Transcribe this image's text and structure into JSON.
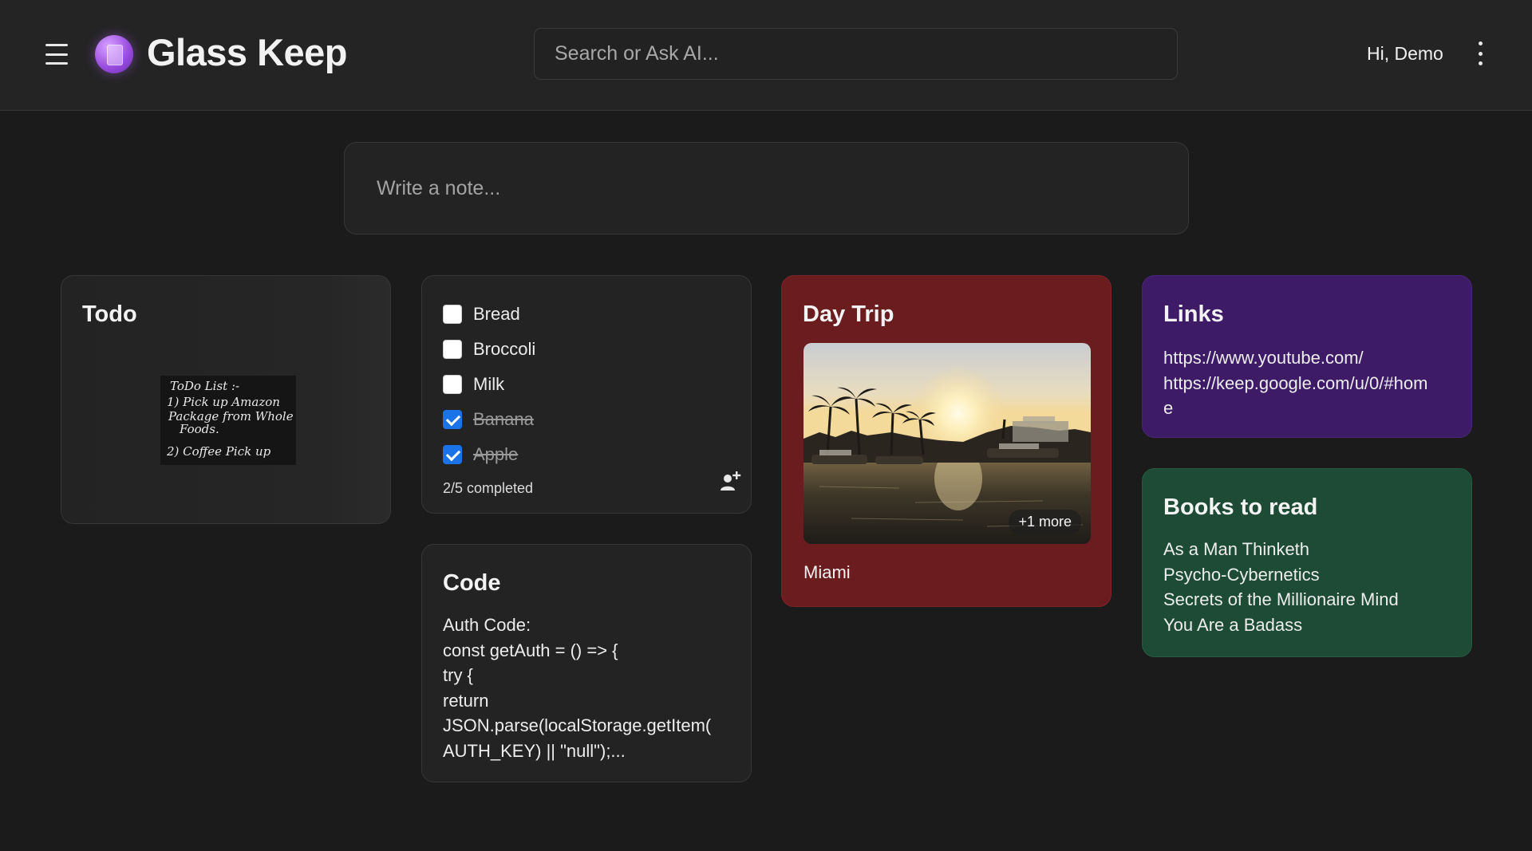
{
  "header": {
    "app_title": "Glass Keep",
    "search_placeholder": "Search or Ask AI...",
    "greeting": "Hi, Demo"
  },
  "composer": {
    "placeholder": "Write a note..."
  },
  "notes": {
    "todo": {
      "title": "Todo",
      "image_lines": [
        "ToDo List :-",
        "1) Pick up Amazon",
        "Package from Whole",
        "Foods.",
        "2) Coffee Pick up"
      ]
    },
    "checklist": {
      "items": [
        {
          "label": "Bread",
          "checked": false
        },
        {
          "label": "Broccoli",
          "checked": false
        },
        {
          "label": "Milk",
          "checked": false
        },
        {
          "label": "Banana",
          "checked": true
        },
        {
          "label": "Apple",
          "checked": true
        }
      ],
      "progress": "2/5 completed"
    },
    "code": {
      "title": "Code",
      "body": "Auth Code:\nconst getAuth = () => {\n  try {\n    return\nJSON.parse(localStorage.getItem(\nAUTH_KEY) || \"null\");..."
    },
    "day_trip": {
      "title": "Day Trip",
      "more_badge": "+1 more",
      "caption": "Miami",
      "color": "#6a1c1e"
    },
    "links": {
      "title": "Links",
      "body": "https://www.youtube.com/\nhttps://keep.google.com/u/0/#hom\ne",
      "color": "#3d1b66"
    },
    "books": {
      "title": "Books to read",
      "body": "As a Man Thinketh\nPsycho-Cybernetics\nSecrets of the Millionaire Mind\nYou Are a Badass",
      "color": "#1d4b36"
    }
  },
  "icons": {
    "menu": "hamburger-menu-icon",
    "logo": "glass-keep-logo-icon",
    "more": "more-vertical-icon",
    "collaborator": "add-collaborator-icon"
  },
  "colors": {
    "background": "#1b1b1b",
    "card": "#232323",
    "checkbox_accent": "#1a73e8"
  }
}
